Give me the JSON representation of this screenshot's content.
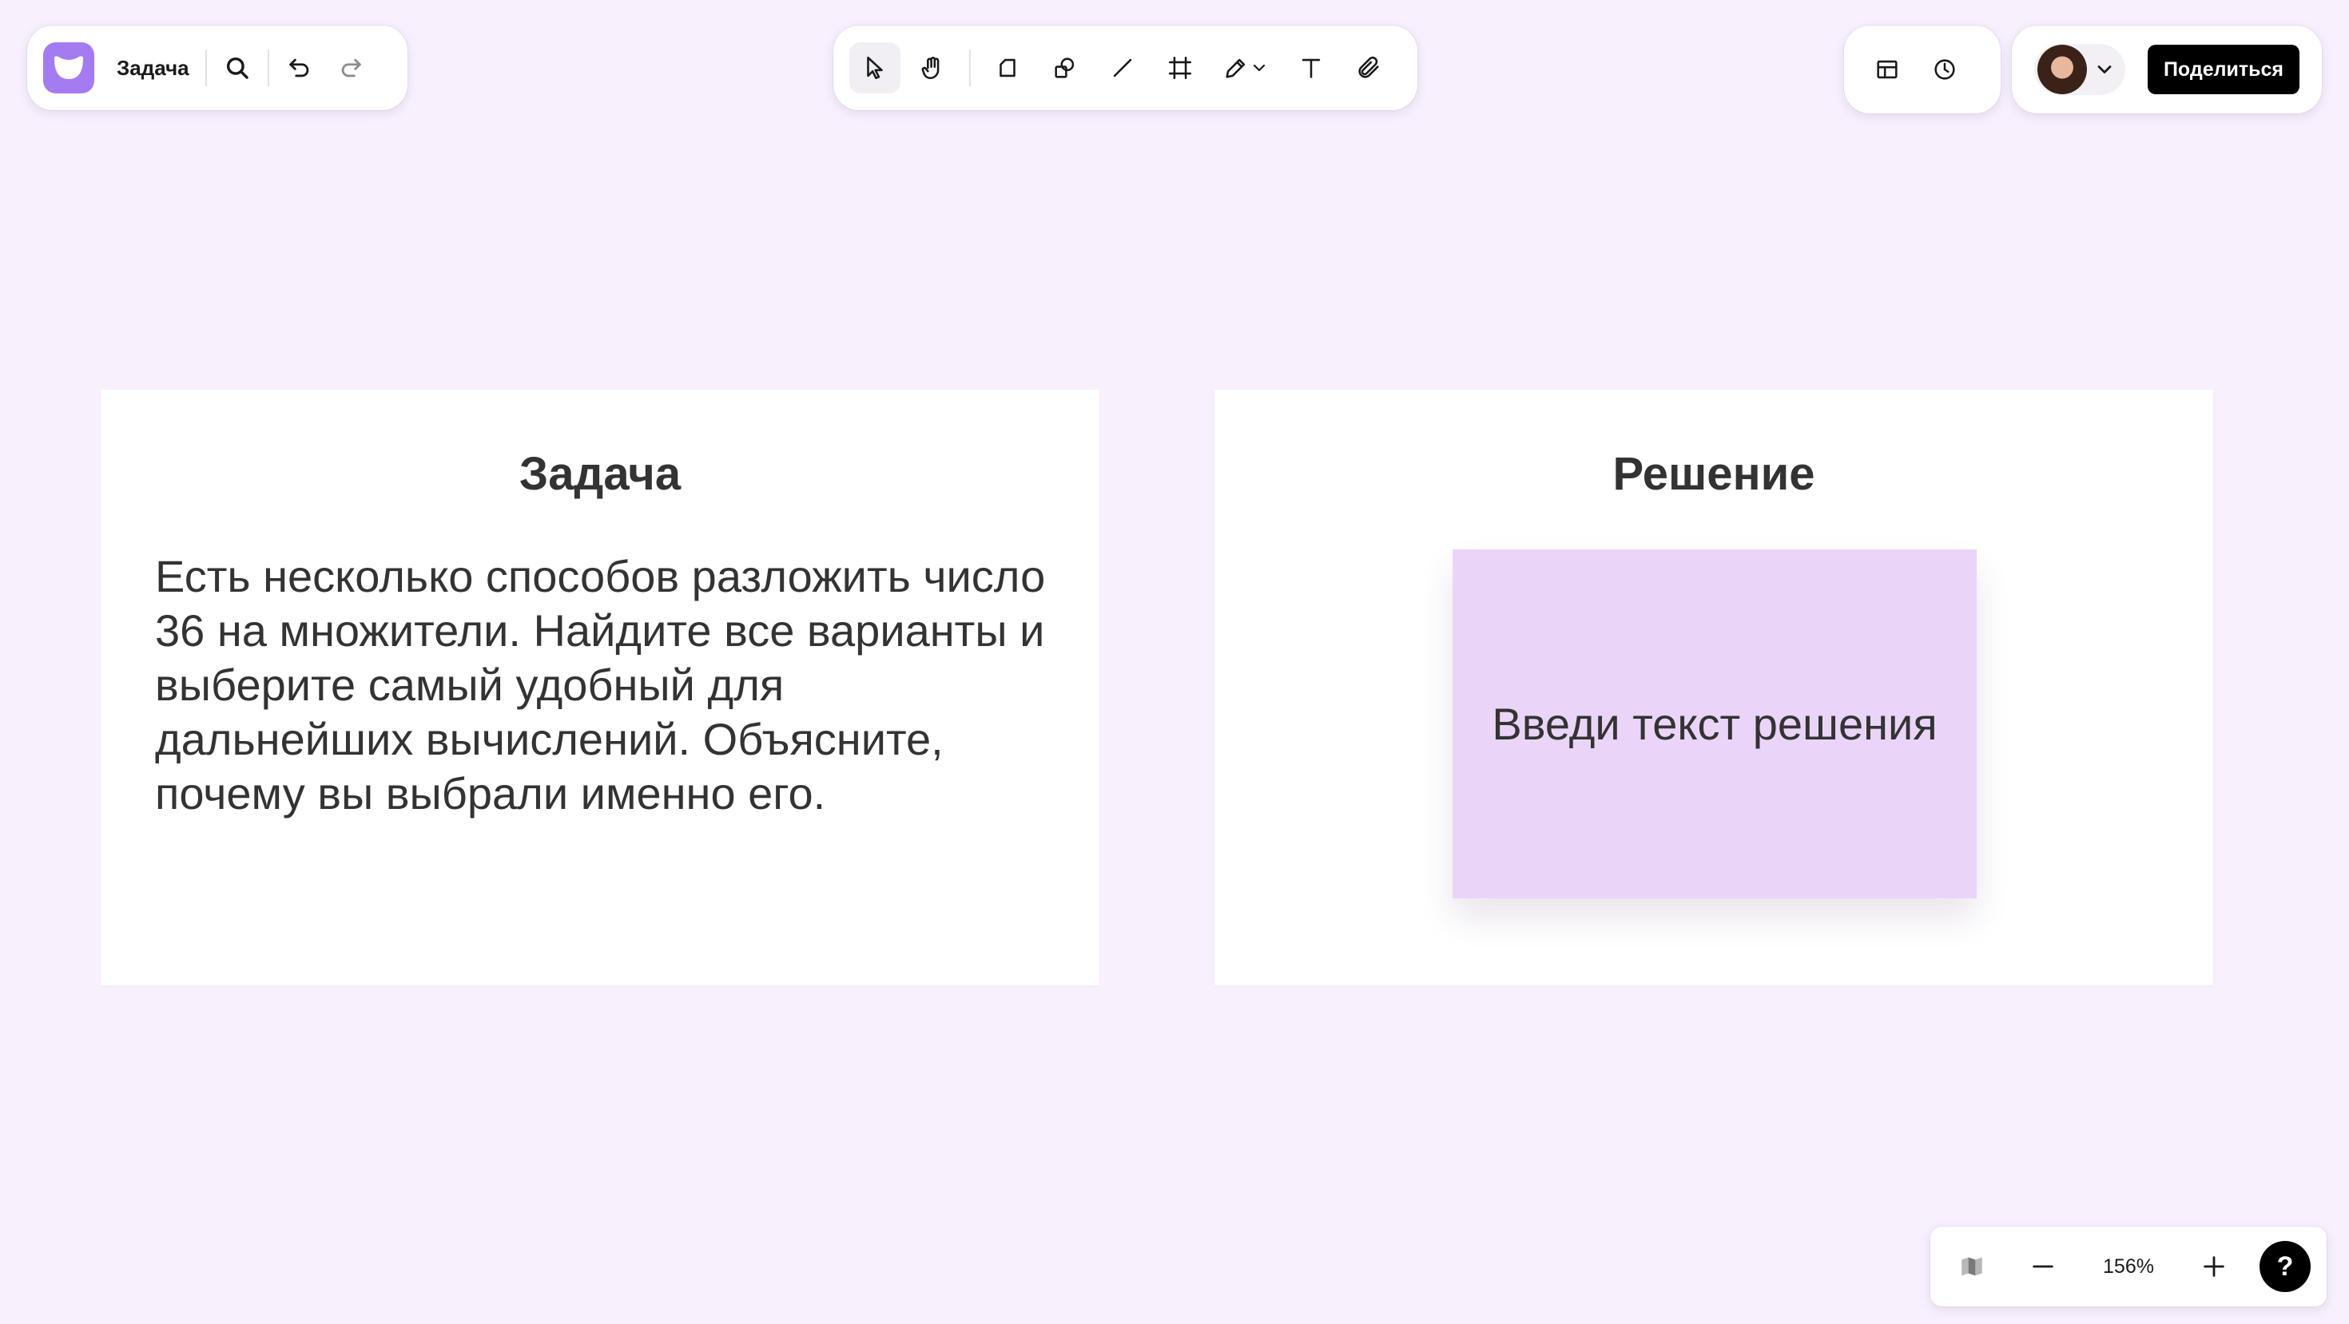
{
  "app": {
    "board_title": "Задача"
  },
  "header": {
    "left_icons": [
      "search-icon",
      "undo-icon",
      "redo-icon"
    ],
    "tools": [
      "select-cursor-icon",
      "hand-icon",
      "sticky-note-icon",
      "shapes-icon",
      "line-icon",
      "frame-icon",
      "pen-icon",
      "text-icon",
      "attachment-icon"
    ],
    "right_icons": [
      "layout-icon",
      "history-clock-icon"
    ],
    "share_label": "Поделиться"
  },
  "canvas": {
    "task_card": {
      "title": "Задача",
      "body": "Есть несколько способов разложить число 36 на множители. Найдите все варианты и выберите самый удобный для дальнейших вычислений. Объясните, почему вы выбрали именно его."
    },
    "solution_card": {
      "title": "Решение",
      "sticky_placeholder": "Введи текст решения"
    }
  },
  "footer": {
    "zoom_level": "156%",
    "help_label": "?"
  },
  "colors": {
    "canvas_bg": "#f8f0fd",
    "brand": "#a57bf2",
    "sticky": "#ead5f9",
    "share_button": "#000000"
  }
}
